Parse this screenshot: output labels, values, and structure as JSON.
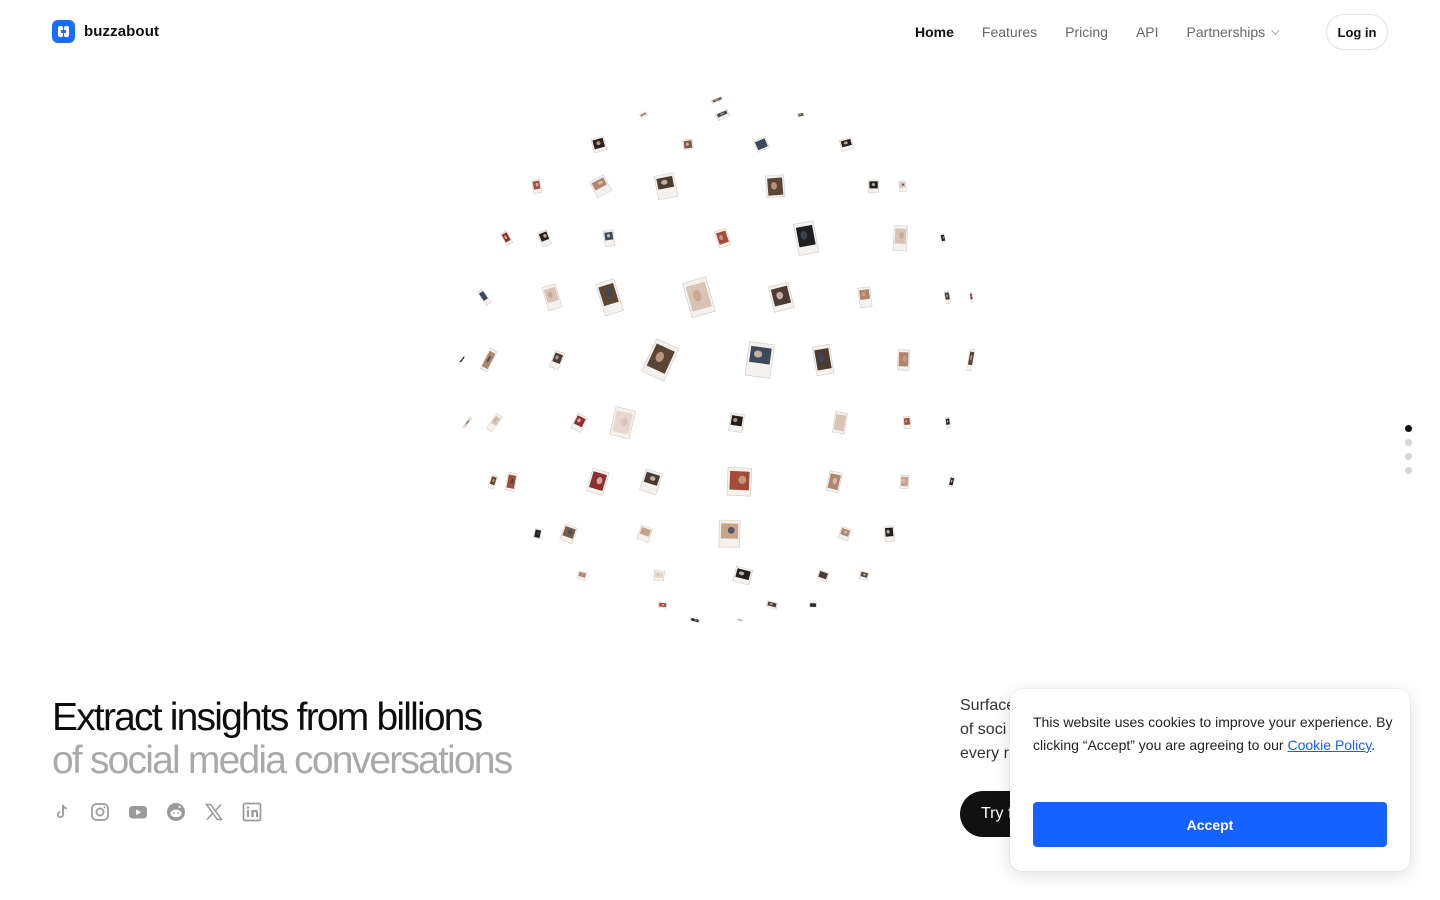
{
  "brand": {
    "name": "buzzabout",
    "accent": "#1a6cff"
  },
  "nav": {
    "items": [
      {
        "label": "Home",
        "active": true
      },
      {
        "label": "Features"
      },
      {
        "label": "Pricing"
      },
      {
        "label": "API"
      }
    ],
    "partnerships_label": "Partnerships",
    "login_label": "Log in"
  },
  "hero": {
    "title_line1": "Extract insights from billions",
    "title_line2": "of social media conversations",
    "subtitle_line1": "Surface",
    "subtitle_line2": "of soci",
    "subtitle_line3": "every r",
    "cta_label": "Try f"
  },
  "socials": [
    "tiktok-icon",
    "instagram-icon",
    "youtube-icon",
    "reddit-icon",
    "x-icon",
    "linkedin-icon"
  ],
  "pager": {
    "count": 4,
    "active_index": 0
  },
  "cookie": {
    "text_before": "This website uses cookies to improve your experience. By clicking “Accept” you are agreeing to our ",
    "link_label": "Cookie Policy",
    "text_after": ".",
    "accept_label": "Accept"
  }
}
